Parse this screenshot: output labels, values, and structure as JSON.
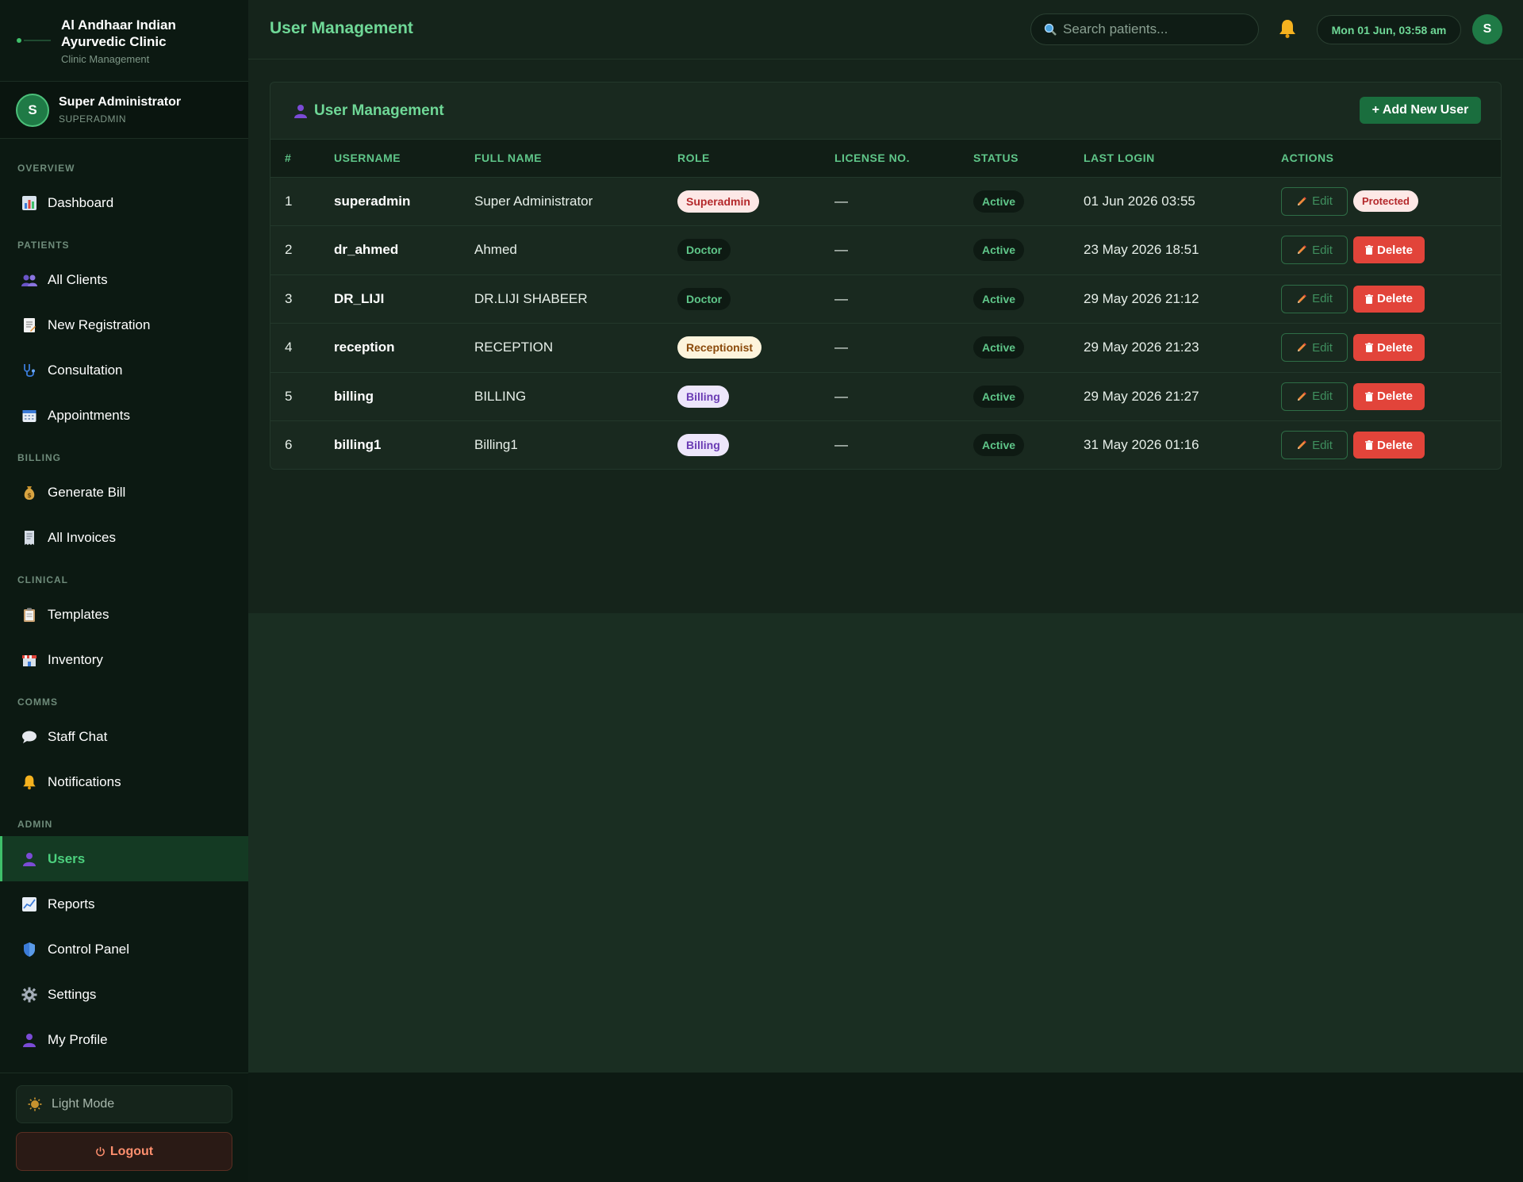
{
  "brand": {
    "name_line1": "Al Andhaar Indian",
    "name_line2": "Ayurvedic Clinic",
    "subtitle": "Clinic Management"
  },
  "user": {
    "initial": "S",
    "name": "Super Administrator",
    "role": "SUPERADMIN"
  },
  "nav": {
    "sections": [
      {
        "title": "OVERVIEW",
        "items": [
          {
            "label": "Dashboard",
            "icon": "bar-chart-icon"
          }
        ]
      },
      {
        "title": "PATIENTS",
        "items": [
          {
            "label": "All Clients",
            "icon": "users-icon"
          },
          {
            "label": "New Registration",
            "icon": "document-icon"
          },
          {
            "label": "Consultation",
            "icon": "stethoscope-icon"
          },
          {
            "label": "Appointments",
            "icon": "calendar-icon"
          }
        ]
      },
      {
        "title": "BILLING",
        "items": [
          {
            "label": "Generate Bill",
            "icon": "money-bag-icon"
          },
          {
            "label": "All Invoices",
            "icon": "receipt-icon"
          }
        ]
      },
      {
        "title": "CLINICAL",
        "items": [
          {
            "label": "Templates",
            "icon": "clipboard-icon"
          },
          {
            "label": "Inventory",
            "icon": "store-icon"
          }
        ]
      },
      {
        "title": "COMMS",
        "items": [
          {
            "label": "Staff Chat",
            "icon": "chat-bubble-icon"
          },
          {
            "label": "Notifications",
            "icon": "bell-icon"
          }
        ]
      },
      {
        "title": "ADMIN",
        "items": [
          {
            "label": "Users",
            "icon": "user-icon",
            "active": true
          },
          {
            "label": "Reports",
            "icon": "line-chart-icon"
          },
          {
            "label": "Control Panel",
            "icon": "shield-icon"
          },
          {
            "label": "Settings",
            "icon": "gear-icon"
          },
          {
            "label": "My Profile",
            "icon": "user-icon"
          }
        ]
      }
    ]
  },
  "bottom": {
    "light_mode": "Light Mode",
    "logout": "Logout"
  },
  "topbar": {
    "title": "User Management",
    "search_placeholder": "Search patients...",
    "datetime": "Mon 01 Jun, 03:58 am",
    "avatar_initial": "S"
  },
  "card": {
    "title": "User Management",
    "add_button": "+ Add New User"
  },
  "table": {
    "headers": [
      "#",
      "USERNAME",
      "FULL NAME",
      "ROLE",
      "LICENSE NO.",
      "STATUS",
      "LAST LOGIN",
      "ACTIONS"
    ],
    "rows": [
      {
        "num": "1",
        "username": "superadmin",
        "full_name": "Super Administrator",
        "role": "Superadmin",
        "role_style": "superadmin",
        "license": "—",
        "status": "Active",
        "last_login": "01 Jun 2026 03:55",
        "edit": "Edit",
        "secondary": "Protected",
        "protected": true
      },
      {
        "num": "2",
        "username": "dr_ahmed",
        "full_name": "Ahmed",
        "role": "Doctor",
        "role_style": "doctor",
        "license": "—",
        "status": "Active",
        "last_login": "23 May 2026 18:51",
        "edit": "Edit",
        "secondary": "Delete",
        "protected": false
      },
      {
        "num": "3",
        "username": "DR_LIJI",
        "full_name": "DR.LIJI SHABEER",
        "role": "Doctor",
        "role_style": "doctor",
        "license": "—",
        "status": "Active",
        "last_login": "29 May 2026 21:12",
        "edit": "Edit",
        "secondary": "Delete",
        "protected": false
      },
      {
        "num": "4",
        "username": "reception",
        "full_name": "RECEPTION",
        "role": "Receptionist",
        "role_style": "receptionist",
        "license": "—",
        "status": "Active",
        "last_login": "29 May 2026 21:23",
        "edit": "Edit",
        "secondary": "Delete",
        "protected": false
      },
      {
        "num": "5",
        "username": "billing",
        "full_name": "BILLING",
        "role": "Billing",
        "role_style": "billing",
        "license": "—",
        "status": "Active",
        "last_login": "29 May 2026 21:27",
        "edit": "Edit",
        "secondary": "Delete",
        "protected": false
      },
      {
        "num": "6",
        "username": "billing1",
        "full_name": "Billing1",
        "role": "Billing",
        "role_style": "billing",
        "license": "—",
        "status": "Active",
        "last_login": "31 May 2026 01:16",
        "edit": "Edit",
        "secondary": "Delete",
        "protected": false
      }
    ]
  },
  "colors": {
    "accent": "#6fd897",
    "active_nav_bg": "#143a23",
    "delete": "#e2443a",
    "add_button": "#1a6e3e"
  }
}
